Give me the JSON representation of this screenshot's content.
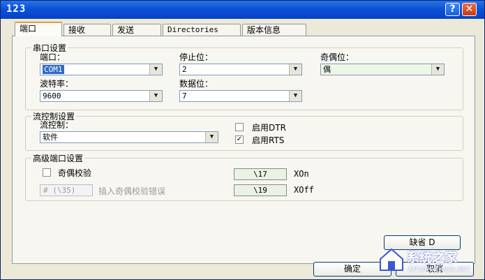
{
  "window": {
    "title": "123",
    "help_glyph": "?",
    "close_glyph": "✕"
  },
  "tabs": [
    "端口",
    "接收",
    "发送",
    "Directories",
    "版本信息"
  ],
  "serial_group": {
    "legend": "串口设置",
    "port": {
      "label": "端口：",
      "value": "COM1"
    },
    "stop_bits": {
      "label": "停止位：",
      "value": "2"
    },
    "parity": {
      "label": "奇偶位：",
      "value": "偶"
    },
    "baud": {
      "label": "波特率：",
      "value": "9600"
    },
    "data_bits": {
      "label": "数据位：",
      "value": "7"
    }
  },
  "flow_group": {
    "legend": "流控制设置",
    "flow": {
      "label": "流控制：",
      "value": "软件"
    },
    "dtr": {
      "label": "启用DTR",
      "checked": false
    },
    "rts": {
      "label": "启用RTS",
      "checked": true
    }
  },
  "adv_group": {
    "legend": "高级端口设置",
    "parity_check": {
      "label": "奇偶校验",
      "checked": false
    },
    "error_char": {
      "value": "# (\\35)",
      "label": "插入奇偶校验错误"
    },
    "xon": {
      "value": "\\17",
      "label": "XOn"
    },
    "xoff": {
      "value": "\\19",
      "label": "XOff"
    }
  },
  "buttons": {
    "default": "缺省 D",
    "ok": "确定",
    "cancel": "取消"
  },
  "watermark": {
    "text": "系统之家",
    "url": "XITONGZHIJIA.NET"
  }
}
